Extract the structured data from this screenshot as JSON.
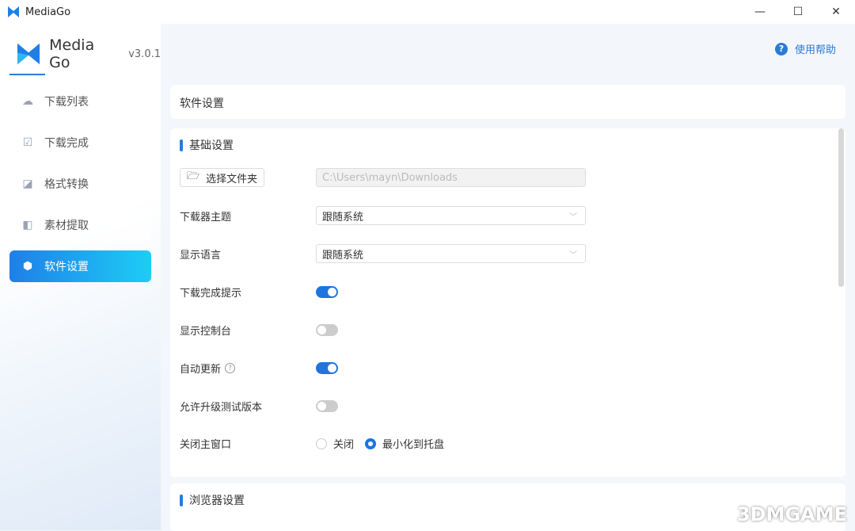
{
  "window": {
    "title": "MediaGo",
    "minimize": "—",
    "maximize": "☐",
    "close": "✕"
  },
  "brand": {
    "name": "Media Go",
    "version": "v3.0.1"
  },
  "help": {
    "label": "使用帮助",
    "icon": "?"
  },
  "sidebar": {
    "items": [
      {
        "label": "下载列表",
        "icon": "cloud-download-icon"
      },
      {
        "label": "下载完成",
        "icon": "check-box-icon"
      },
      {
        "label": "格式转换",
        "icon": "convert-icon"
      },
      {
        "label": "素材提取",
        "icon": "extract-icon"
      },
      {
        "label": "软件设置",
        "icon": "settings-icon",
        "active": true
      }
    ]
  },
  "page": {
    "title": "软件设置"
  },
  "basic": {
    "heading": "基础设置",
    "folder_button": "选择文件夹",
    "folder_path": "C:\\Users\\mayn\\Downloads",
    "theme_label": "下载器主题",
    "theme_value": "跟随系统",
    "lang_label": "显示语言",
    "lang_value": "跟随系统",
    "notify_label": "下载完成提示",
    "notify_on": true,
    "console_label": "显示控制台",
    "console_on": false,
    "autoupdate_label": "自动更新",
    "autoupdate_on": true,
    "beta_label": "允许升级测试版本",
    "beta_on": false,
    "close_label": "关闭主窗口",
    "close_opt1": "关闭",
    "close_opt2": "最小化到托盘",
    "close_selected": "最小化到托盘"
  },
  "browser": {
    "heading": "浏览器设置"
  },
  "watermark": "3DMGAME"
}
